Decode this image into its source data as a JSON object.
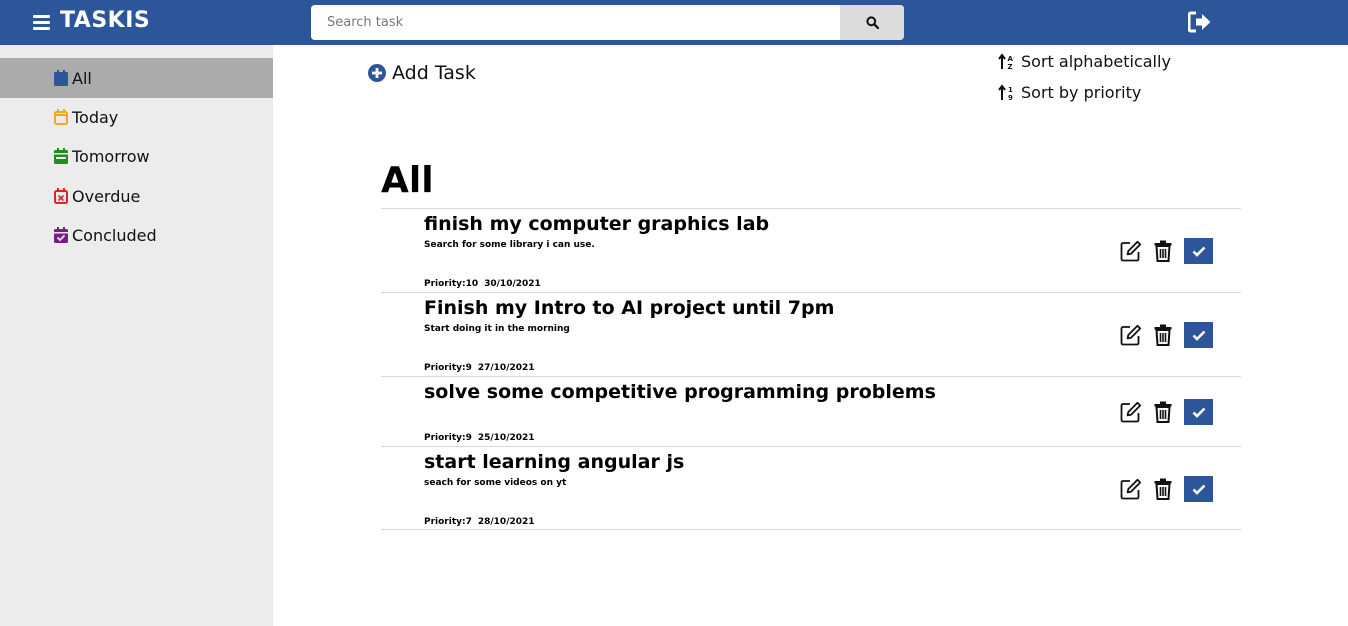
{
  "header": {
    "brand": "TASKIS",
    "search_placeholder": "Search task",
    "search_value": "",
    "menu_icon": "hamburger-menu-icon",
    "search_icon": "search-icon",
    "logout_icon": "sign-out-icon",
    "color": "#2d5599"
  },
  "sidebar": {
    "items": [
      {
        "label": "All",
        "icon": "calendar-icon",
        "color": "#2d5599",
        "active": true
      },
      {
        "label": "Today",
        "icon": "calendar-outline-icon",
        "color": "#f5a623",
        "active": false
      },
      {
        "label": "Tomorrow",
        "icon": "calendar-minus-icon",
        "color": "#1e8f1e",
        "active": false
      },
      {
        "label": "Overdue",
        "icon": "calendar-x-icon",
        "color": "#e02424",
        "active": false
      },
      {
        "label": "Concluded",
        "icon": "calendar-check-icon",
        "color": "#7b1b8a",
        "active": false
      }
    ]
  },
  "toolbar": {
    "add_task_label": "Add Task",
    "sort_alpha_label": "Sort alphabetically",
    "sort_priority_label": "Sort by priority"
  },
  "main": {
    "section_title": "All",
    "tasks": [
      {
        "title": "finish my computer graphics lab",
        "description": "Search for some library i can use.",
        "priority": "Priority:10",
        "date": "30/10/2021"
      },
      {
        "title": "Finish my Intro to AI project until 7pm",
        "description": "Start doing it in the morning",
        "priority": "Priority:9",
        "date": "27/10/2021"
      },
      {
        "title": "solve some competitive programming problems",
        "description": "",
        "priority": "Priority:9",
        "date": "25/10/2021"
      },
      {
        "title": "start learning angular js",
        "description": "seach for some videos on yt",
        "priority": "Priority:7",
        "date": "28/10/2021"
      }
    ]
  }
}
